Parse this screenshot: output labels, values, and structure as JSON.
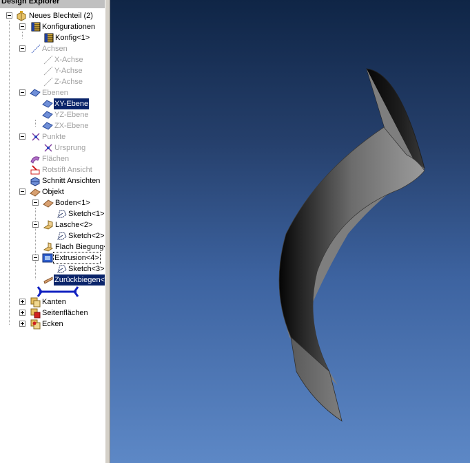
{
  "explorer": {
    "title": "Design Explorer",
    "items": [
      {
        "label": "Neues Blechteil (2)",
        "icon": "sheet-metal-part-icon"
      },
      {
        "label": "Konfigurationen",
        "icon": "configurations-icon"
      },
      {
        "label": "Konfig<1>",
        "icon": "configuration-icon"
      },
      {
        "label": "Achsen",
        "icon": "axes-icon"
      },
      {
        "label": "X-Achse",
        "icon": "axis-icon"
      },
      {
        "label": "Y-Achse",
        "icon": "axis-icon"
      },
      {
        "label": "Z-Achse",
        "icon": "axis-icon"
      },
      {
        "label": "Ebenen",
        "icon": "planes-icon"
      },
      {
        "label": "XY-Ebene",
        "icon": "plane-icon"
      },
      {
        "label": "YZ-Ebene",
        "icon": "plane-icon"
      },
      {
        "label": "ZX-Ebene",
        "icon": "plane-icon"
      },
      {
        "label": "Punkte",
        "icon": "points-icon"
      },
      {
        "label": "Ursprung",
        "icon": "origin-icon"
      },
      {
        "label": "Flächen",
        "icon": "surfaces-icon"
      },
      {
        "label": "Rotstift Ansicht",
        "icon": "redline-view-icon"
      },
      {
        "label": "Schnitt Ansichten",
        "icon": "section-views-icon"
      },
      {
        "label": "Objekt",
        "icon": "object-icon"
      },
      {
        "label": "Boden<1>",
        "icon": "base-flange-icon"
      },
      {
        "label": "Sketch<1>",
        "icon": "sketch-icon"
      },
      {
        "label": "Lasche<2>",
        "icon": "tab-flange-icon"
      },
      {
        "label": "Sketch<2>",
        "icon": "sketch-icon"
      },
      {
        "label": "Flach Biegung<",
        "icon": "flat-bend-icon"
      },
      {
        "label": "Extrusion<4>",
        "icon": "extrusion-icon"
      },
      {
        "label": "Sketch<3>",
        "icon": "sketch-icon"
      },
      {
        "label": "Zurückbiegen<",
        "icon": "unbend-icon"
      },
      {
        "label": "Kanten",
        "icon": "edges-icon"
      },
      {
        "label": "Seitenflächen",
        "icon": "faces-icon"
      },
      {
        "label": "Ecken",
        "icon": "corners-icon"
      }
    ]
  },
  "colors": {
    "selection": "#0a246a",
    "disabled_text": "#a0a0a0",
    "viewport_top": "#0f2546",
    "viewport_bottom": "#5d88c6",
    "part_gray": "#7f7f7f",
    "rollback_bar": "#1020c0"
  }
}
